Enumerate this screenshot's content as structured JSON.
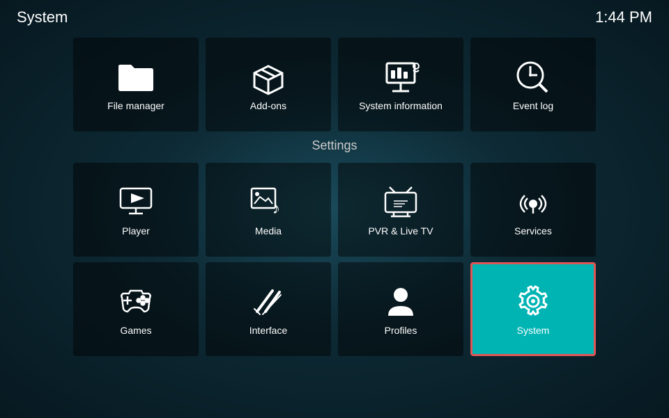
{
  "header": {
    "title": "System",
    "time": "1:44 PM"
  },
  "top_tiles": [
    {
      "id": "file-manager",
      "label": "File manager",
      "icon": "folder"
    },
    {
      "id": "add-ons",
      "label": "Add-ons",
      "icon": "box"
    },
    {
      "id": "system-information",
      "label": "System information",
      "icon": "projector"
    },
    {
      "id": "event-log",
      "label": "Event log",
      "icon": "clock-search"
    }
  ],
  "settings_label": "Settings",
  "settings_rows": [
    [
      {
        "id": "player",
        "label": "Player",
        "icon": "player",
        "active": false
      },
      {
        "id": "media",
        "label": "Media",
        "icon": "media",
        "active": false
      },
      {
        "id": "pvr-live-tv",
        "label": "PVR & Live TV",
        "icon": "tv",
        "active": false
      },
      {
        "id": "services",
        "label": "Services",
        "icon": "services",
        "active": false
      }
    ],
    [
      {
        "id": "games",
        "label": "Games",
        "icon": "games",
        "active": false
      },
      {
        "id": "interface",
        "label": "Interface",
        "icon": "interface",
        "active": false
      },
      {
        "id": "profiles",
        "label": "Profiles",
        "icon": "profiles",
        "active": false
      },
      {
        "id": "system",
        "label": "System",
        "icon": "system",
        "active": true
      }
    ]
  ]
}
